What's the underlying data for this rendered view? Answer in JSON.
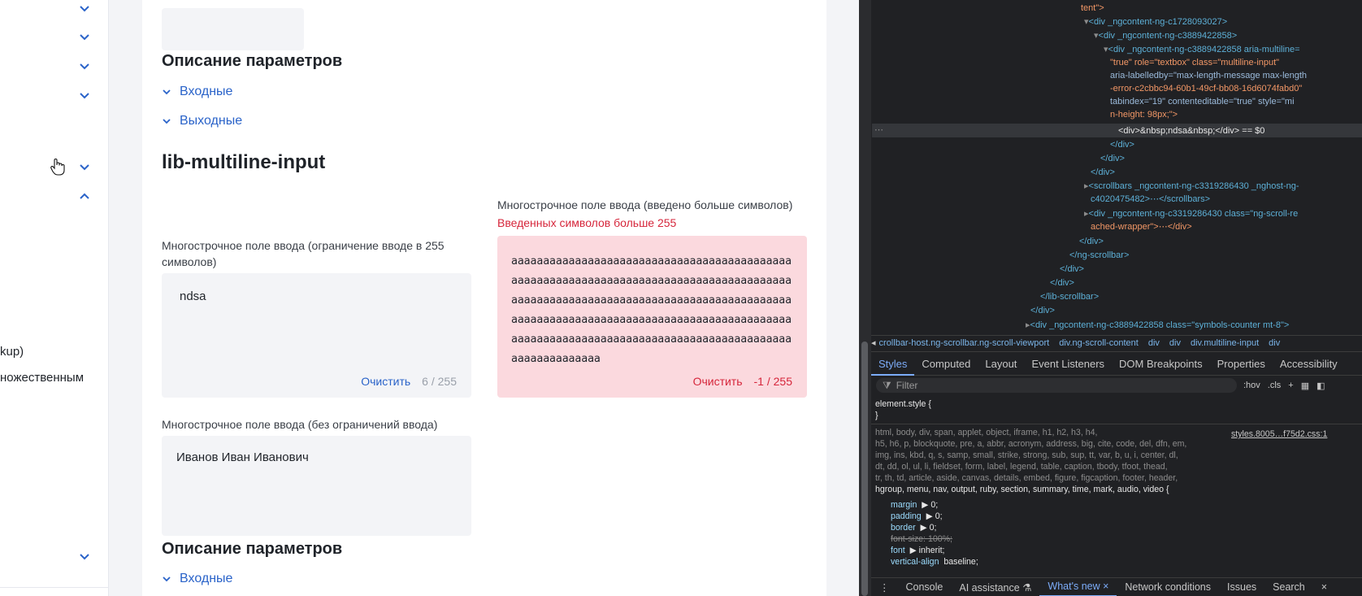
{
  "sidebar": {
    "items": [
      {
        "text": "kup)"
      },
      {
        "text": "ножественным"
      }
    ]
  },
  "content": {
    "section1": {
      "params_title": "Описание параметров",
      "inputs_label": "Входные",
      "outputs_label": "Выходные"
    },
    "component_title": "lib-multiline-input",
    "field_limited": {
      "label": "Многострочное поле ввода (ограничение вводе в 255 символов)",
      "value": "ndsa",
      "clear": "Очистить",
      "counter": "6 / 255"
    },
    "field_over": {
      "label": "Многострочное поле ввода (введено больше символов)",
      "error": "Введенных символов больше 255",
      "value": "aaaaaaaaaaaaaaaaaaaaaaaaaaaaaaaaaaaaaaaaaaaaaaaaaaaaaaaaaaaaaaaaaaaaaaaaaaaaaaaaaaaaaaaaaaaaaaaaaaaaaaaaaaaaaaaaaaaaaaaaaaaaaaaaaaaaaaaaaaaaaaaaaaaaaaaaaaaaaaaaaaaaaaaaaaaaaaaaaaaaaaaaaaaaaaaaaaaaaaaaaaaaaaaaaaaaaaaaaaaaaaaaaaaaaaaaaa",
      "clear": "Очистить",
      "counter": "-1 / 255"
    },
    "field_unlimited": {
      "label": "Многострочное поле ввода (без ограничений ввода)",
      "value": "Иванов Иван Иванович"
    },
    "section2": {
      "params_title": "Описание параметров",
      "inputs_label": "Входные"
    }
  },
  "devtools": {
    "dom": [
      "tent\">",
      "<div _ngcontent-ng-c1728093027>",
      "<div _ngcontent-ng-c3889422858>",
      "<div _ngcontent-ng-c3889422858 aria-multiline=",
      "\"true\" role=\"textbox\" class=\"multiline-input\"",
      "aria-labelledby=\"max-length-message max-length",
      "-error-c2cbbc94-60b1-49cf-bb08-16d6074fabd0\"",
      "tabindex=\"19\" contenteditable=\"true\" style=\"mi",
      "n-height: 98px;\">",
      "<div>&nbsp;ndsa&nbsp;</div> == $0",
      "</div>",
      "</div>",
      "</div>",
      "<scrollbars _ngcontent-ng-c3319286430 _nghost-ng-",
      "c4020475482>⋯</scrollbars>",
      "<div _ngcontent-ng-c3319286430 class=\"ng-scroll-re",
      "ached-wrapper\">⋯</div>",
      "</div>",
      "</ng-scrollbar>",
      "</div>",
      "</div>",
      "</lib-scrollbar>",
      "</div>",
      "<div _ngcontent-ng-c3889422858 class=\"symbols-counter mt-8\">"
    ],
    "crumbs": [
      "crollbar-host.ng-scrollbar.ng-scroll-viewport",
      "div.ng-scroll-content",
      "div",
      "div",
      "div.multiline-input",
      "div"
    ],
    "tabs": [
      "Styles",
      "Computed",
      "Layout",
      "Event Listeners",
      "DOM Breakpoints",
      "Properties",
      "Accessibility"
    ],
    "filter_placeholder": "Filter",
    "filter_tools": [
      ":hov",
      ".cls",
      "+"
    ],
    "css": {
      "element_style": "element.style {",
      "close": "}",
      "selector1": "html, body, div, span, applet, object, iframe, h1, h2, h3, h4,",
      "selector2": "h5, h6, p, blockquote, pre, a, abbr, acronym, address, big, cite, code, del, dfn, em,",
      "selector3": "img, ins, kbd, q, s, samp, small, strike, strong, sub, sup, tt, var, b, u, i, center, dl,",
      "selector4": "dt, dd, ol, ul, li, fieldset, form, label, legend, table, caption, tbody, tfoot, thead,",
      "selector5": "tr, th, td, article, aside, canvas, details, embed, figure, figcaption, footer, header,",
      "selector6": "hgroup, menu, nav, output, ruby, section, summary, time, mark, audio, video {",
      "source": "styles.8005…f75d2.css:1",
      "props": [
        {
          "name": "margin",
          "value": "▶ 0;"
        },
        {
          "name": "padding",
          "value": "▶ 0;"
        },
        {
          "name": "border",
          "value": "▶ 0;"
        },
        {
          "name": "font-size",
          "value": "100%;"
        },
        {
          "name": "font",
          "value": "▶ inherit;"
        },
        {
          "name": "vertical-align",
          "value": "baseline;"
        }
      ]
    },
    "drawer": [
      "Console",
      "AI assistance ⚗",
      "What's new ×",
      "Network conditions",
      "Issues",
      "Search"
    ]
  },
  "colors": {
    "accent": "#2a63c9",
    "error": "#d6263b",
    "error_bg": "#fbd9de",
    "field_bg": "#f3f4f7",
    "devtools_bg": "#202124"
  }
}
